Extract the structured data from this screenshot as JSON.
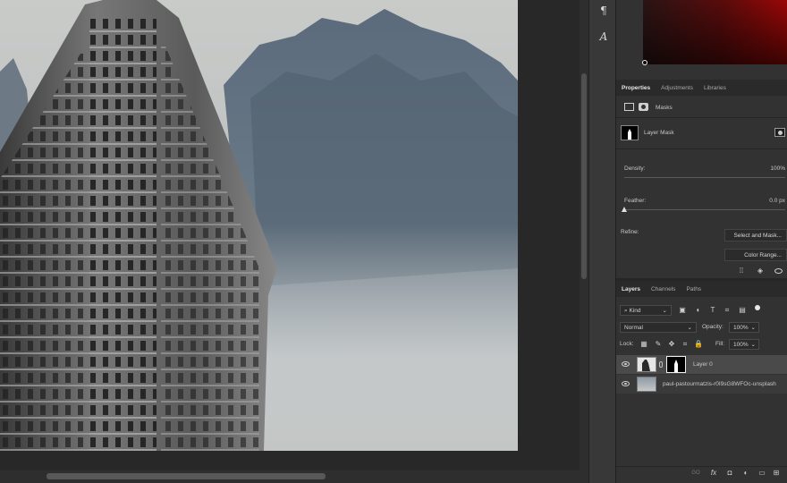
{
  "colors": {
    "accent_red": "#8b0a0a",
    "panel_bg": "#323232",
    "canvas_bg": "#282828"
  },
  "strip": {
    "icons": [
      "pilcrow-icon",
      "character-icon"
    ],
    "glyphs": [
      "¶",
      "𝐴"
    ]
  },
  "properties": {
    "tabs": [
      "Properties",
      "Adjustments",
      "Libraries"
    ],
    "masks_label": "Masks",
    "layer_mask_label": "Layer Mask",
    "density_label": "Density:",
    "density_value": "100%",
    "feather_label": "Feather:",
    "feather_value": "0.0 px",
    "refine_label": "Refine:",
    "select_and_mask": "Select and Mask...",
    "color_range": "Color Range..."
  },
  "layers": {
    "tabs": [
      "Layers",
      "Channels",
      "Paths"
    ],
    "kind_label": "Kind",
    "blend_mode": "Normal",
    "opacity_label": "Opacity:",
    "opacity_value": "100%",
    "lock_label": "Lock:",
    "fill_label": "Fill:",
    "fill_value": "100%",
    "items": [
      {
        "name": "Layer 0"
      },
      {
        "name": "paul-pastourmatzis-r0I9sG8WFOc-unsplash"
      }
    ],
    "footer_icons": [
      "link-icon",
      "fx-icon",
      "mask-icon",
      "adjustment-icon",
      "group-icon",
      "new-layer-icon",
      "trash-icon"
    ],
    "footer_glyphs": [
      "GO",
      "fx",
      "◘",
      "◐",
      "▭",
      "⊞",
      "🗑"
    ]
  }
}
